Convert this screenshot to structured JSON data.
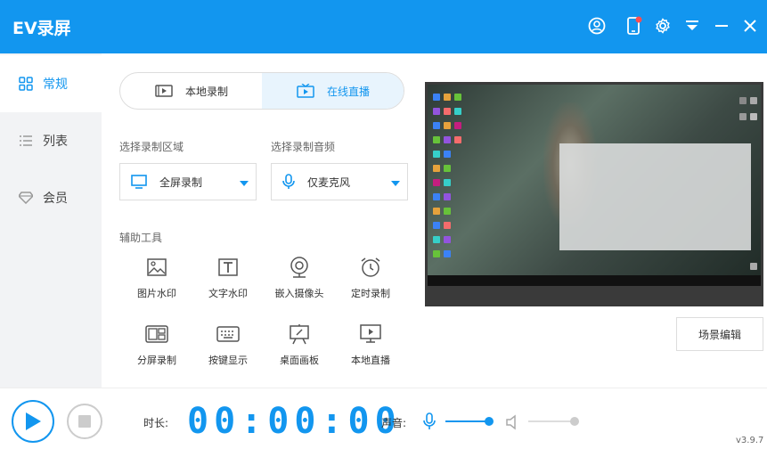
{
  "app": {
    "title": "EV录屏"
  },
  "titlebar_icons": [
    "user-icon",
    "phone-notification-icon",
    "gear-icon",
    "dropdown-menu-icon",
    "minimize-icon",
    "close-icon"
  ],
  "sidebar": {
    "items": [
      {
        "label": "常规",
        "icon": "grid-icon",
        "active": true
      },
      {
        "label": "列表",
        "icon": "list-icon",
        "active": false
      },
      {
        "label": "会员",
        "icon": "diamond-icon",
        "active": false
      }
    ]
  },
  "modes": {
    "local": "本地录制",
    "online": "在线直播"
  },
  "area": {
    "label": "选择录制区域",
    "value": "全屏录制"
  },
  "audio": {
    "label": "选择录制音频",
    "value": "仅麦克风"
  },
  "tools": {
    "label": "辅助工具",
    "items": [
      {
        "label": "图片水印",
        "icon": "image-icon"
      },
      {
        "label": "文字水印",
        "icon": "text-icon"
      },
      {
        "label": "嵌入摄像头",
        "icon": "webcam-icon"
      },
      {
        "label": "定时录制",
        "icon": "alarm-clock-icon"
      },
      {
        "label": "分屏录制",
        "icon": "split-screen-icon"
      },
      {
        "label": "按键显示",
        "icon": "keyboard-icon"
      },
      {
        "label": "桌面画板",
        "icon": "drawing-board-icon"
      },
      {
        "label": "本地直播",
        "icon": "monitor-play-icon"
      }
    ]
  },
  "scene_edit": "场景编辑",
  "controls": {
    "duration_label": "时长:",
    "timer": "00:00:00",
    "volume_label": "声音:",
    "mic_level": 0.95,
    "speaker_level": 1.0
  },
  "version": "v3.9.7",
  "colors": {
    "accent": "#1296ef",
    "sidebar_bg": "#f2f3f5"
  }
}
